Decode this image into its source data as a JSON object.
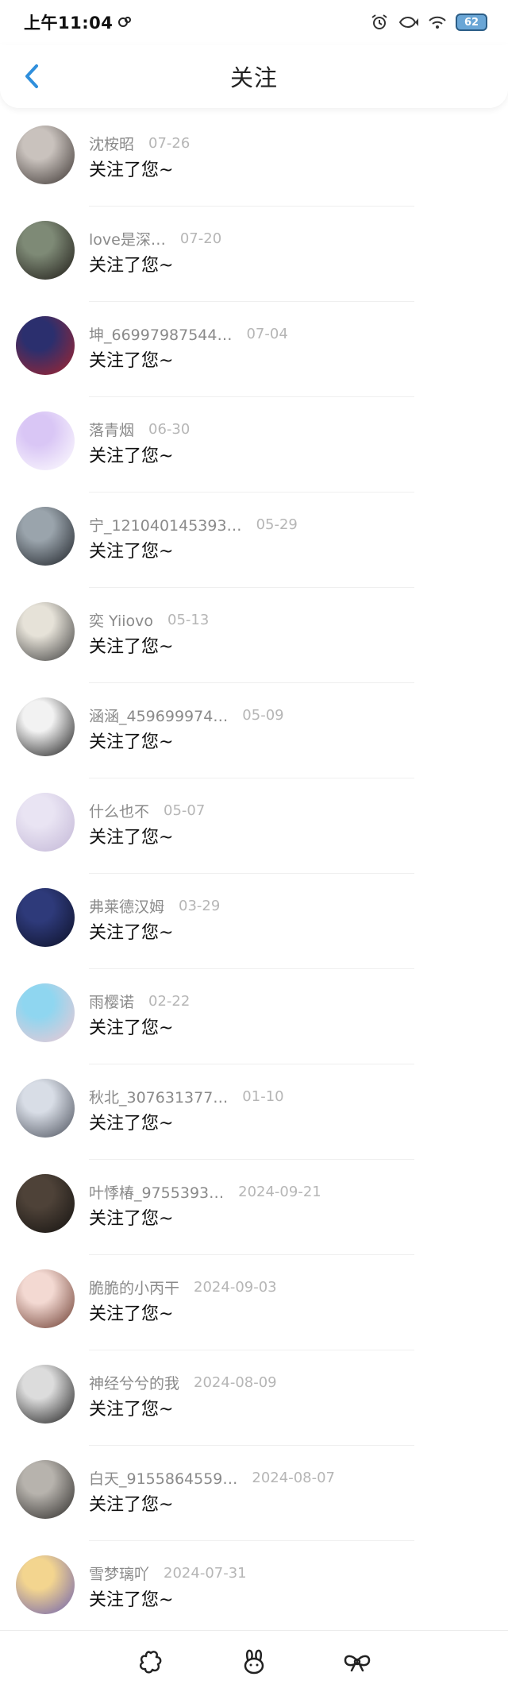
{
  "status_bar": {
    "time": "上午11:04",
    "battery": "62"
  },
  "header": {
    "title": "关注"
  },
  "notifications": [
    {
      "name": "沈桉昭",
      "date": "07-26",
      "action": "关注了您~",
      "avatar_colors": [
        "#c9c2bd",
        "#3a3330"
      ]
    },
    {
      "name": "love是深…",
      "date": "07-20",
      "action": "关注了您~",
      "avatar_colors": [
        "#7e8a76",
        "#1e1a16"
      ]
    },
    {
      "name": "坤_66997987544…",
      "date": "07-04",
      "action": "关注了您~",
      "avatar_colors": [
        "#2b2f6e",
        "#a8242c"
      ]
    },
    {
      "name": "落青烟",
      "date": "06-30",
      "action": "关注了您~",
      "avatar_colors": [
        "#d9c6f5",
        "#ffffff"
      ]
    },
    {
      "name": "宁_121040145393…",
      "date": "05-29",
      "action": "关注了您~",
      "avatar_colors": [
        "#9aa4ac",
        "#1c2026"
      ]
    },
    {
      "name": "奕 Yiiovo",
      "date": "05-13",
      "action": "关注了您~",
      "avatar_colors": [
        "#e6e2d8",
        "#3c3c3c"
      ]
    },
    {
      "name": "涵涵_459699974…",
      "date": "05-09",
      "action": "关注了您~",
      "avatar_colors": [
        "#f2f2f2",
        "#1a1a1a"
      ]
    },
    {
      "name": "什么也不",
      "date": "05-07",
      "action": "关注了您~",
      "avatar_colors": [
        "#e9e4f3",
        "#c2b6d6"
      ]
    },
    {
      "name": "弗莱德汉姆",
      "date": "03-29",
      "action": "关注了您~",
      "avatar_colors": [
        "#2e3a7a",
        "#0c1026"
      ]
    },
    {
      "name": "雨樱诺",
      "date": "02-22",
      "action": "关注了您~",
      "avatar_colors": [
        "#8fd6f0",
        "#f2c7d2"
      ]
    },
    {
      "name": "秋北_307631377…",
      "date": "01-10",
      "action": "关注了您~",
      "avatar_colors": [
        "#d8dde6",
        "#4a4f5a"
      ]
    },
    {
      "name": "叶悸椿_9755393…",
      "date": "2024-09-21",
      "action": "关注了您~",
      "avatar_colors": [
        "#4e4238",
        "#141210"
      ]
    },
    {
      "name": "脆脆的小丙干",
      "date": "2024-09-03",
      "action": "关注了您~",
      "avatar_colors": [
        "#f3d9d2",
        "#6b3a2e"
      ]
    },
    {
      "name": "神经兮兮的我",
      "date": "2024-08-09",
      "action": "关注了您~",
      "avatar_colors": [
        "#dcdcdc",
        "#1b1b1b"
      ]
    },
    {
      "name": "白天_9155864559…",
      "date": "2024-08-07",
      "action": "关注了您~",
      "avatar_colors": [
        "#b7b3ad",
        "#2c2a28"
      ]
    },
    {
      "name": "雪梦璃吖",
      "date": "2024-07-31",
      "action": "关注了您~",
      "avatar_colors": [
        "#f3d58f",
        "#6c5fb0"
      ]
    }
  ],
  "bottom_bar": {
    "icons": [
      "flower-outline-icon",
      "bunny-outline-icon",
      "bow-outline-icon"
    ]
  },
  "colors": {
    "accent": "#2f8fdc",
    "name_text": "#8a8a8a",
    "date_text": "#b6b6b6"
  }
}
